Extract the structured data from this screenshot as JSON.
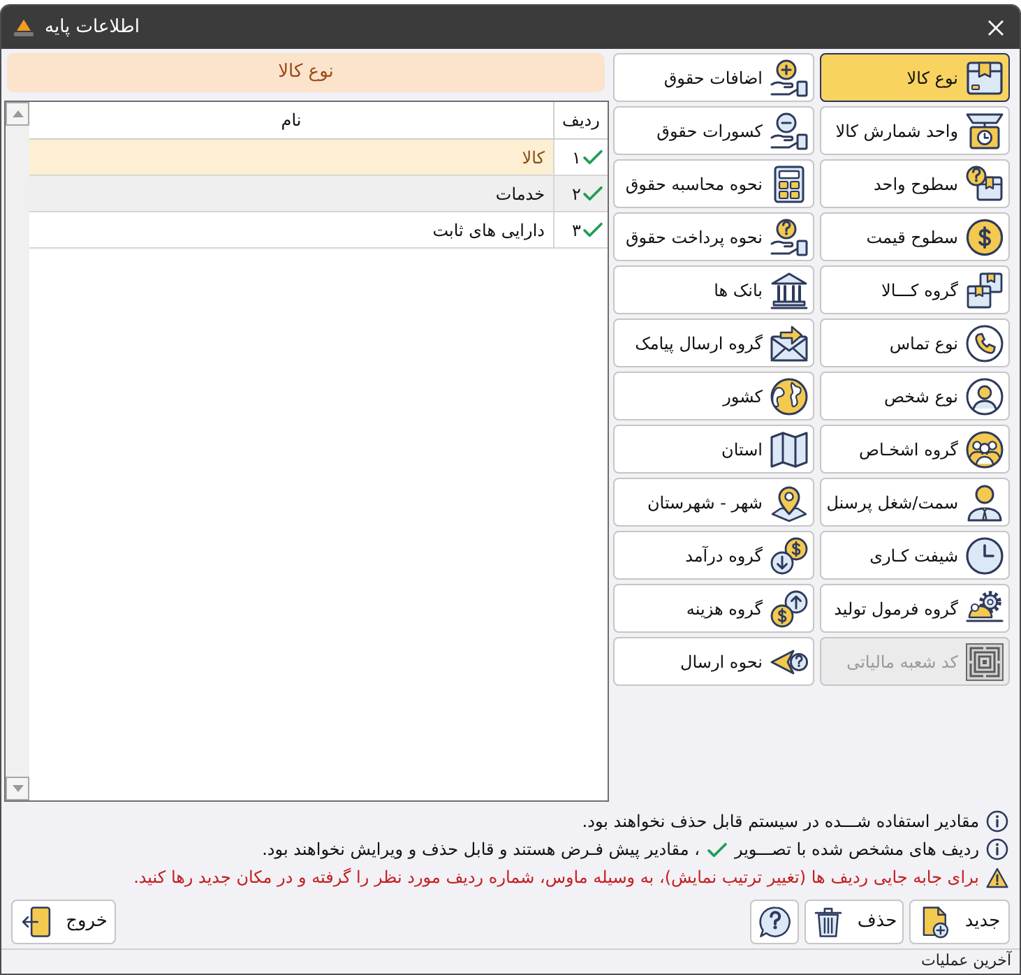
{
  "window": {
    "title": "اطلاعات پایه"
  },
  "section_header": "نوع کالا",
  "table": {
    "columns": [
      "ردیف",
      "نام"
    ],
    "rows": [
      {
        "row": "۱",
        "name": "کالا",
        "default": true,
        "selected": true
      },
      {
        "row": "۲",
        "name": "خدمات",
        "default": true,
        "selected": false
      },
      {
        "row": "۳",
        "name": "دارایی های ثابت",
        "default": true,
        "selected": false
      }
    ]
  },
  "category_buttons": {
    "right_column": [
      {
        "label": "نوع کالا",
        "selected": true,
        "disabled": false
      },
      {
        "label": "واحد شمارش کالا",
        "selected": false,
        "disabled": false
      },
      {
        "label": "سطوح واحد",
        "selected": false,
        "disabled": false
      },
      {
        "label": "سطوح قیمت",
        "selected": false,
        "disabled": false
      },
      {
        "label": "گروه کـــالا",
        "selected": false,
        "disabled": false
      },
      {
        "label": "نوع تماس",
        "selected": false,
        "disabled": false
      },
      {
        "label": "نوع شخص",
        "selected": false,
        "disabled": false
      },
      {
        "label": "گروه اشخـاص",
        "selected": false,
        "disabled": false
      },
      {
        "label": "سمت/شغل پرسنل",
        "selected": false,
        "disabled": false
      },
      {
        "label": "شیفت کـاری",
        "selected": false,
        "disabled": false
      },
      {
        "label": "گروه فرمول تولید",
        "selected": false,
        "disabled": false
      },
      {
        "label": "کد شعبه مالیاتی",
        "selected": false,
        "disabled": true
      }
    ],
    "left_column": [
      {
        "label": "اضافات حقوق",
        "selected": false,
        "disabled": false
      },
      {
        "label": "کسورات حقوق",
        "selected": false,
        "disabled": false
      },
      {
        "label": "نحوه محاسبه حقوق",
        "selected": false,
        "disabled": false
      },
      {
        "label": "نحوه پرداخت حقوق",
        "selected": false,
        "disabled": false
      },
      {
        "label": "بانک ها",
        "selected": false,
        "disabled": false
      },
      {
        "label": "گروه ارسال پیامک",
        "selected": false,
        "disabled": false
      },
      {
        "label": "کشور",
        "selected": false,
        "disabled": false
      },
      {
        "label": "استان",
        "selected": false,
        "disabled": false
      },
      {
        "label": "شهر - شهرستان",
        "selected": false,
        "disabled": false
      },
      {
        "label": "گروه درآمد",
        "selected": false,
        "disabled": false
      },
      {
        "label": "گروه هزینه",
        "selected": false,
        "disabled": false
      },
      {
        "label": "نحوه ارسال",
        "selected": false,
        "disabled": false
      }
    ]
  },
  "notes": [
    {
      "kind": "info",
      "parts": [
        "مقادیر استفاده شـــده در سیستم قابل حذف نخواهند بود."
      ]
    },
    {
      "kind": "info",
      "parts": [
        "ردیف های مشخص شده با تصـــویر",
        "، مقادیر پیش فـرض هستند و قابل حذف و ویرایش نخواهند بود."
      ]
    },
    {
      "kind": "warning",
      "parts": [
        "برای جابه جایی ردیف ها (تغییر ترتیب نمایش)، به وسیله ماوس، شماره ردیف مورد نظر را گرفته و در مکان جدید رها کنید."
      ]
    }
  ],
  "actions": [
    {
      "kind": "new",
      "label": "جدید"
    },
    {
      "kind": "delete",
      "label": "حذف"
    },
    {
      "kind": "help"
    },
    {
      "kind": "exit",
      "label": "خروج"
    }
  ],
  "status_bar": "آخرین عملیات"
}
